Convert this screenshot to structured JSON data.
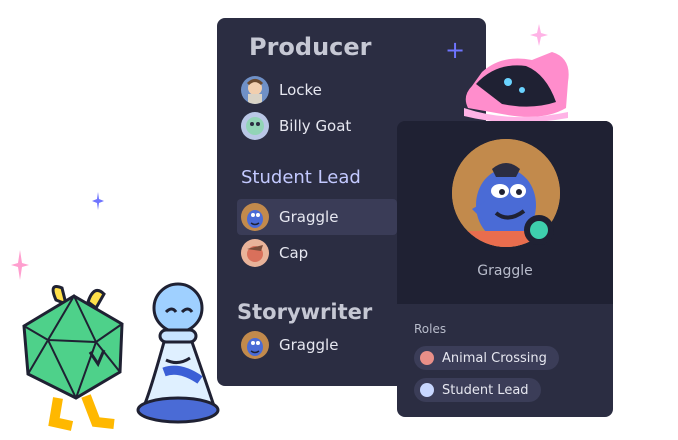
{
  "panel": {
    "roles": [
      {
        "name": "Producer",
        "members": [
          "Locke",
          "Billy Goat"
        ]
      },
      {
        "name": "Student Lead",
        "members": [
          "Graggle",
          "Cap"
        ]
      },
      {
        "name": "Storywriter",
        "members": [
          "Graggle"
        ]
      }
    ],
    "add_icon": "plus-icon"
  },
  "profile_card": {
    "username": "Graggle",
    "roles_label": "Roles",
    "roles": [
      {
        "name": "Animal Crossing",
        "color": "#e98f88"
      },
      {
        "name": "Student Lead",
        "color": "#c8d7ff"
      }
    ],
    "status_color": "#3ecfad"
  },
  "decorations": [
    "d20-character",
    "chess-pawn-character",
    "sneaker",
    "sparkle-icons"
  ]
}
